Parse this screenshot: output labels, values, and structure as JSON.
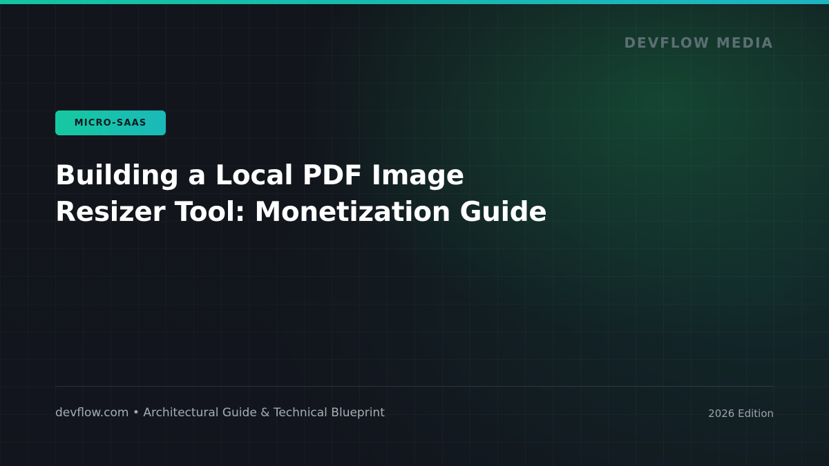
{
  "brand": {
    "name": "DEVFLOW MEDIA"
  },
  "badge": {
    "label": "MICRO-SAAS"
  },
  "headline": {
    "line1": "Building a Local PDF Image",
    "line2": "Resizer Tool: Monetization Guide"
  },
  "footer": {
    "site": "devflow.com",
    "separator": "•",
    "subtitle": "Architectural Guide & Technical Blueprint",
    "edition": "2026 Edition"
  },
  "colors": {
    "accent": "#16c9a0",
    "background": "#12151c",
    "headline_text": "#ffffff",
    "brand_text": "#5c6f73",
    "footer_text": "#a4adb6"
  }
}
